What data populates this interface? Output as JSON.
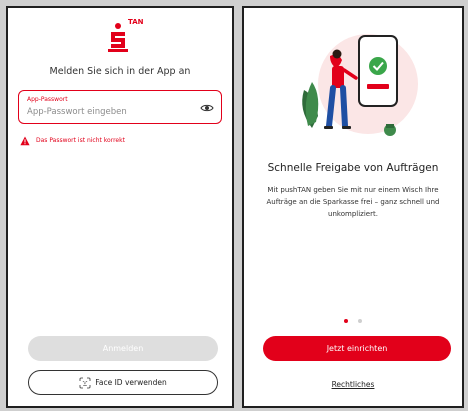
{
  "login_screen": {
    "logo_badge": "TAN",
    "title": "Melden Sie sich in der App an",
    "password_field": {
      "label": "App-Passwort",
      "placeholder": "App-Passwort eingeben",
      "value": ""
    },
    "error_message": "Das Passwort ist nicht korrekt",
    "login_button": "Anmelden",
    "faceid_button": "Face ID verwenden"
  },
  "onboarding_screen": {
    "title": "Schnelle Freigabe von Aufträgen",
    "description": "Mit pushTAN geben Sie mit nur einem Wisch Ihre Aufträge an die Sparkasse frei – ganz schnell und unkompliziert.",
    "pager": {
      "current": 1,
      "total": 2
    },
    "setup_button": "Jetzt einrichten",
    "legal_link": "Rechtliches"
  },
  "colors": {
    "brand_red": "#e2001a",
    "disabled_button": "#dedede",
    "success_green": "#3aa64a"
  },
  "icons": {
    "logo": "sparkasse-logo-icon",
    "eye": "eye-icon",
    "warning": "warning-icon",
    "face_id": "face-id-icon",
    "illustration": "phone-approval-illustration"
  }
}
